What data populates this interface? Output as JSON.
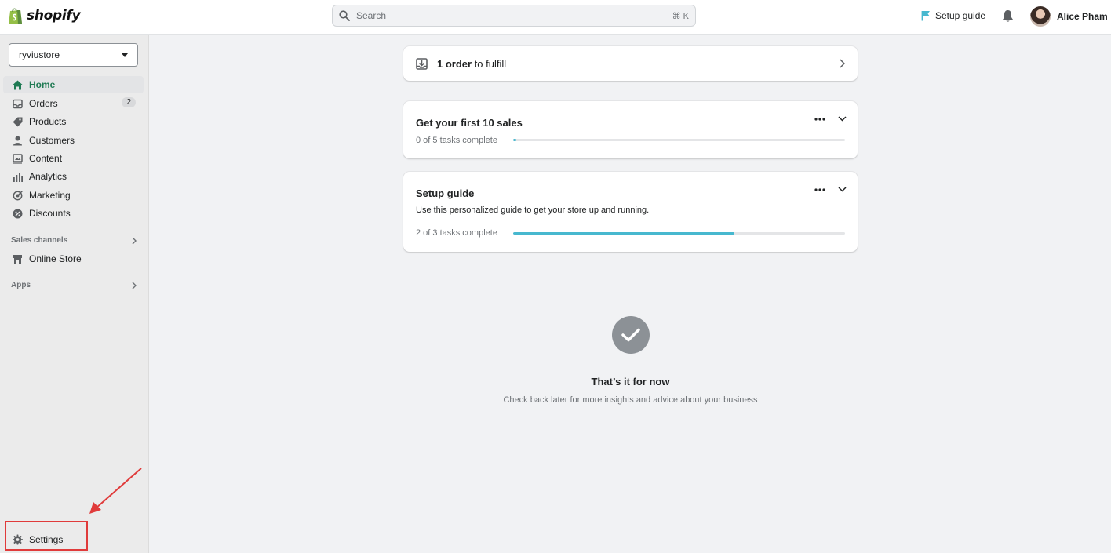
{
  "header": {
    "brand": "shopify",
    "search_placeholder": "Search",
    "search_shortcut": "⌘ K",
    "setup_guide_label": "Setup guide",
    "user_name": "Alice Pham"
  },
  "sidebar": {
    "store_name": "ryviustore",
    "items": [
      {
        "label": "Home",
        "icon": "home-icon",
        "active": true
      },
      {
        "label": "Orders",
        "icon": "inbox-icon",
        "badge": "2"
      },
      {
        "label": "Products",
        "icon": "tag-icon"
      },
      {
        "label": "Customers",
        "icon": "person-icon"
      },
      {
        "label": "Content",
        "icon": "image-icon"
      },
      {
        "label": "Analytics",
        "icon": "bar-chart-icon"
      },
      {
        "label": "Marketing",
        "icon": "target-icon"
      },
      {
        "label": "Discounts",
        "icon": "discount-icon"
      }
    ],
    "sales_channels_label": "Sales channels",
    "online_store_label": "Online Store",
    "apps_label": "Apps",
    "settings_label": "Settings"
  },
  "main": {
    "order_card": {
      "count_text": "1 order",
      "rest_text": " to fulfill"
    },
    "sales_card": {
      "title": "Get your first 10 sales",
      "progress_text": "0 of 5 tasks complete",
      "progress_fraction": 0.01
    },
    "setup_card": {
      "title": "Setup guide",
      "description": "Use this personalized guide to get your store up and running.",
      "progress_text": "2 of 3 tasks complete",
      "progress_fraction": 0.667
    },
    "done": {
      "title": "That’s it for now",
      "subtitle": "Check back later for more insights and advice about your business"
    }
  },
  "colors": {
    "accent": "#1f7a53",
    "progress": "#47b8cf",
    "annotation": "#e03b3b"
  }
}
